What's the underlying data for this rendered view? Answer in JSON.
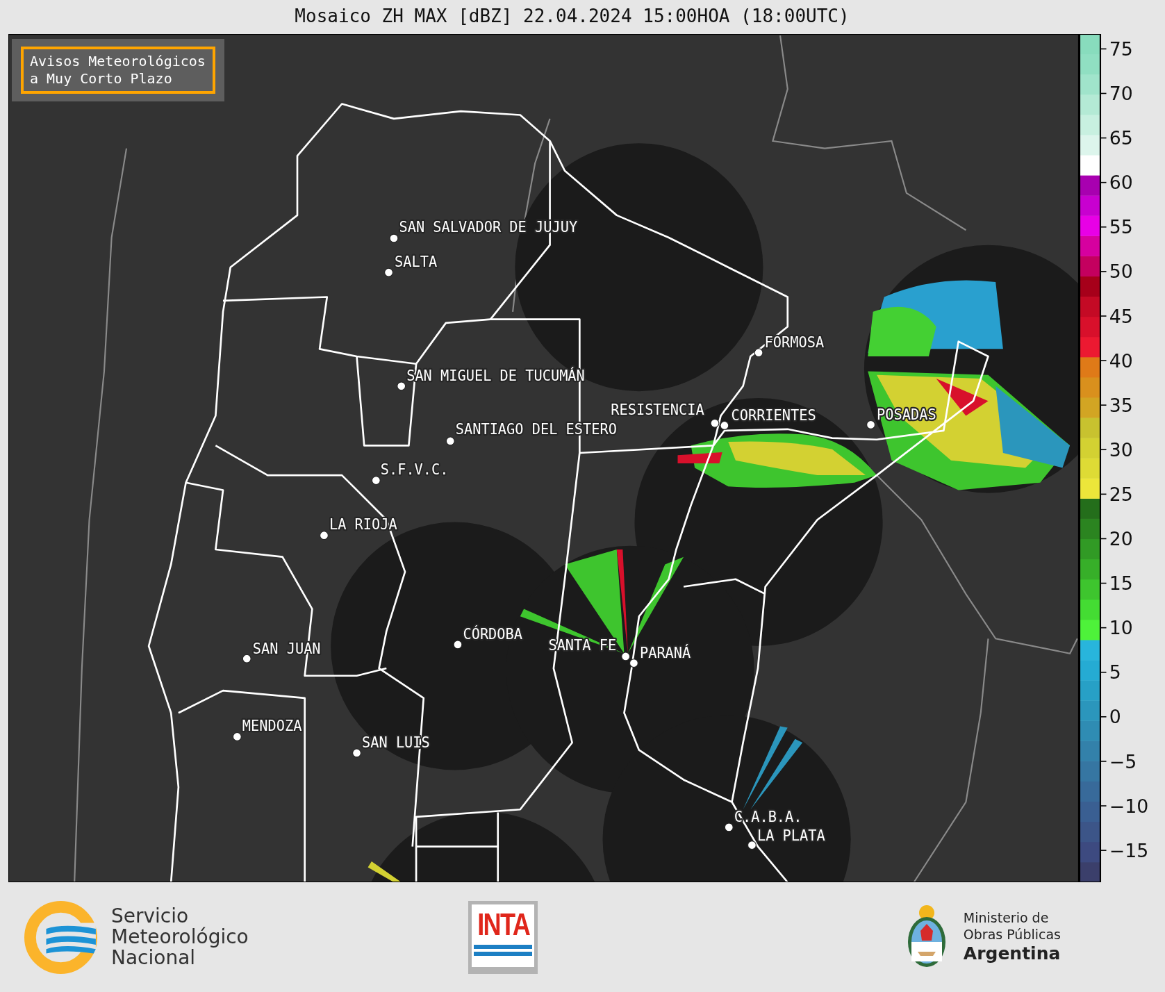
{
  "title": "Mosaico ZH MAX [dBZ] 22.04.2024 15:00HOA (18:00UTC)",
  "map": {
    "notice": [
      "Avisos Meteorológicos",
      "a Muy Corto Plazo"
    ],
    "cities": [
      {
        "name": "SAN SALVADOR DE JUJUY"
      },
      {
        "name": "SALTA"
      },
      {
        "name": "FORMOSA"
      },
      {
        "name": "SAN MIGUEL DE TUCUMÁN"
      },
      {
        "name": "RESISTENCIA"
      },
      {
        "name": "CORRIENTES"
      },
      {
        "name": "POSADAS"
      },
      {
        "name": "SANTIAGO DEL ESTERO"
      },
      {
        "name": "S.F.V.C."
      },
      {
        "name": "LA RIOJA"
      },
      {
        "name": "CÓRDOBA"
      },
      {
        "name": "SAN JUAN"
      },
      {
        "name": "SANTA FE"
      },
      {
        "name": "PARANÁ"
      },
      {
        "name": "MENDOZA"
      },
      {
        "name": "SAN LUIS"
      },
      {
        "name": "C.A.B.A."
      },
      {
        "name": "LA PLATA"
      }
    ]
  },
  "colorbar": {
    "ticks": [
      "75",
      "70",
      "65",
      "60",
      "55",
      "50",
      "45",
      "40",
      "35",
      "30",
      "25",
      "20",
      "15",
      "10",
      "5",
      "0",
      "−5",
      "−10",
      "−15"
    ]
  },
  "footer": {
    "logos": [
      {
        "kind": "smn",
        "lines": [
          "Servicio",
          "Meteorológico",
          "Nacional"
        ]
      },
      {
        "kind": "inta",
        "text": "INTA"
      },
      {
        "kind": "ministry",
        "lines": [
          "Ministerio de",
          "Obras Públicas",
          "Argentina"
        ]
      }
    ]
  }
}
